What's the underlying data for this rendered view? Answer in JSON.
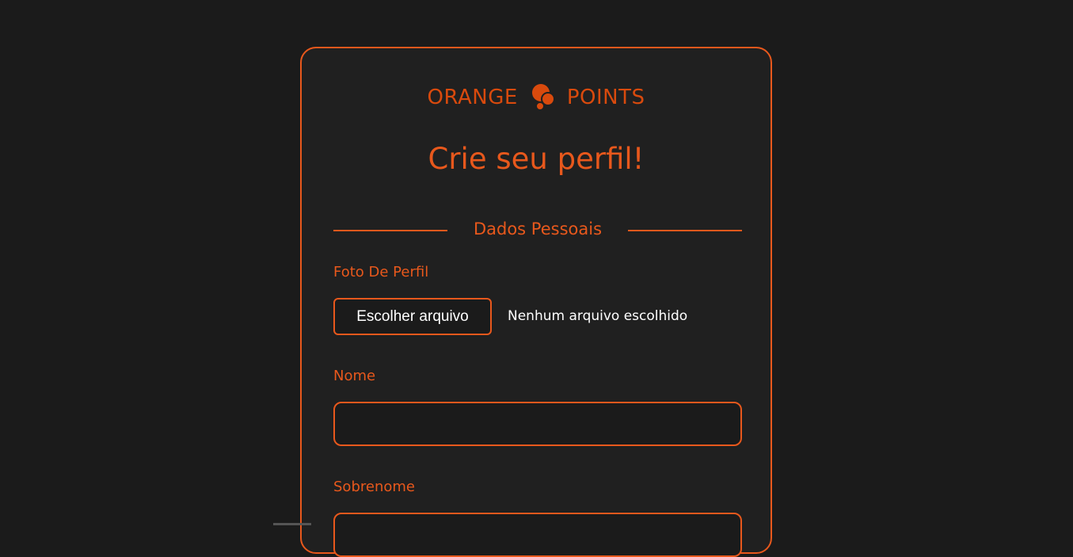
{
  "brand": {
    "left_word": "ORANGE",
    "right_word": "POINTS",
    "icon": "orange-dots-logo-icon",
    "color": "#d94a0d"
  },
  "page": {
    "title": "Crie seu perfil!"
  },
  "section": {
    "title": "Dados Pessoais"
  },
  "fields": {
    "photo": {
      "label": "Foto De Perfil",
      "button_label": "Escolher arquivo",
      "status": "Nenhum arquivo escolhido"
    },
    "first_name": {
      "label": "Nome",
      "value": ""
    },
    "last_name": {
      "label": "Sobrenome",
      "value": ""
    }
  },
  "colors": {
    "accent": "#e8581c",
    "background": "#1b1b1b",
    "card": "#202020"
  }
}
